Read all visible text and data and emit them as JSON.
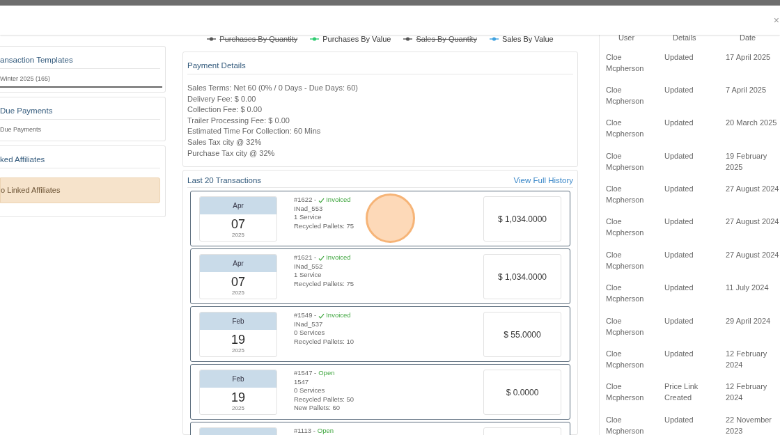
{
  "header": {
    "close": "×"
  },
  "sidebar": {
    "panels": [
      {
        "title": "ansaction Templates",
        "lines": [
          "Winter 2025 (165)"
        ],
        "underlined": true
      },
      {
        "title": "Due Payments",
        "lines": [
          "Due Payments"
        ],
        "underlined": false
      },
      {
        "title": "ked Affiliates",
        "alert": "o Linked Affiliates"
      }
    ]
  },
  "legend": [
    {
      "label": "Purchases By Quantity",
      "color": "#555555",
      "hidden": true
    },
    {
      "label": "Purchases By Value",
      "color": "#2ecc71",
      "hidden": false
    },
    {
      "label": "Sales By Quantity",
      "color": "#555555",
      "hidden": true
    },
    {
      "label": "Sales By Value",
      "color": "#3fa2e0",
      "hidden": false
    }
  ],
  "payment_details": {
    "title": "Payment Details",
    "lines": [
      "Sales Terms: Net 60 (0% / 0 Days - Due Days: 60)",
      "Delivery Fee: $ 0.00",
      "Collection Fee: $ 0.00",
      "Trailer Processing Fee: $ 0.00",
      "Estimated Time For Collection: 60 Mins",
      "Sales Tax city @ 32%",
      "Purchase Tax city @ 32%"
    ]
  },
  "transactions": {
    "title": "Last 20 Transactions",
    "link": "View Full History",
    "items": [
      {
        "month": "Apr",
        "day": "07",
        "year": "2025",
        "number": "#1622 -",
        "status": {
          "kind": "invoiced",
          "label": "Invoiced"
        },
        "lines": [
          "INad_553",
          "1 Service",
          "Recycled Pallets: 75"
        ],
        "amount": "$ 1,034.0000"
      },
      {
        "month": "Apr",
        "day": "07",
        "year": "2025",
        "number": "#1621 -",
        "status": {
          "kind": "invoiced",
          "label": "Invoiced"
        },
        "lines": [
          "INad_552",
          "1 Service",
          "Recycled Pallets: 75"
        ],
        "amount": "$ 1,034.0000"
      },
      {
        "month": "Feb",
        "day": "19",
        "year": "2025",
        "number": "#1549 -",
        "status": {
          "kind": "invoiced",
          "label": "Invoiced"
        },
        "lines": [
          "INad_537",
          "0 Services",
          "Recycled Pallets: 10"
        ],
        "amount": "$ 55.0000"
      },
      {
        "month": "Feb",
        "day": "19",
        "year": "2025",
        "number": "#1547 -",
        "status": {
          "kind": "open",
          "label": "Open"
        },
        "lines": [
          "1547",
          "0 Services",
          "Recycled Pallets: 50",
          "New Pallets: 60"
        ],
        "amount": "$ 0.0000"
      },
      {
        "number": "#1113 -",
        "status": {
          "kind": "open",
          "label": "Open"
        }
      }
    ]
  },
  "history": {
    "columns": [
      "User",
      "Details",
      "Date"
    ],
    "rows": [
      [
        "Cloe Mcpherson",
        "Updated",
        "17 April 2025"
      ],
      [
        "Cloe Mcpherson",
        "Updated",
        "7 April 2025"
      ],
      [
        "Cloe Mcpherson",
        "Updated",
        "20 March 2025"
      ],
      [
        "Cloe Mcpherson",
        "Updated",
        "19 February 2025"
      ],
      [
        "Cloe Mcpherson",
        "Updated",
        "27 August 2024"
      ],
      [
        "Cloe Mcpherson",
        "Updated",
        "27 August 2024"
      ],
      [
        "Cloe Mcpherson",
        "Updated",
        "27 August 2024"
      ],
      [
        "Cloe Mcpherson",
        "Updated",
        "11 July 2024"
      ],
      [
        "Cloe Mcpherson",
        "Updated",
        "29 April 2024"
      ],
      [
        "Cloe Mcpherson",
        "Updated",
        "12 February 2024"
      ],
      [
        "Cloe Mcpherson",
        "Price Link Created",
        "12 February 2024"
      ],
      [
        "Cloe Mcpherson",
        "Updated",
        "22 November 2023"
      ]
    ]
  }
}
